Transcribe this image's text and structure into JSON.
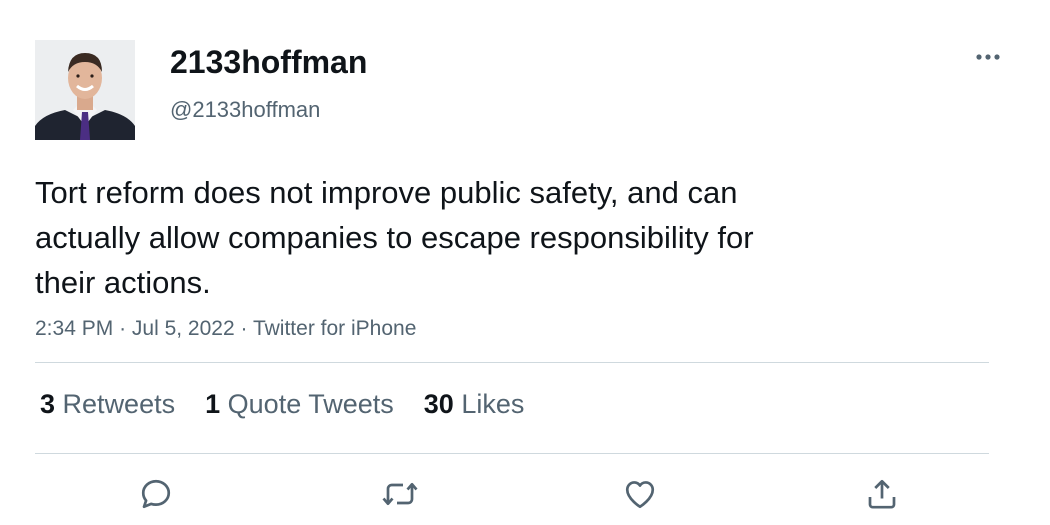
{
  "author": {
    "display_name": "2133hoffman",
    "handle": "@2133hoffman"
  },
  "tweet": {
    "text": "Tort reform does not improve public safety, and can\nactually allow companies to escape responsibility for\ntheir actions.",
    "time": "2:34 PM",
    "separator": "·",
    "date": "Jul 5, 2022",
    "source": "Twitter for iPhone"
  },
  "stats": {
    "retweets": {
      "count": "3",
      "label": "Retweets"
    },
    "quote_tweets": {
      "count": "1",
      "label": "Quote Tweets"
    },
    "likes": {
      "count": "30",
      "label": "Likes"
    }
  },
  "icons": {
    "more": "more-horizontal-icon",
    "reply": "reply-icon",
    "retweet": "retweet-icon",
    "like": "heart-icon",
    "share": "share-icon"
  },
  "colors": {
    "text_primary": "#0f1419",
    "text_secondary": "#536471",
    "divider": "#cfd9de",
    "icon": "#536471"
  }
}
